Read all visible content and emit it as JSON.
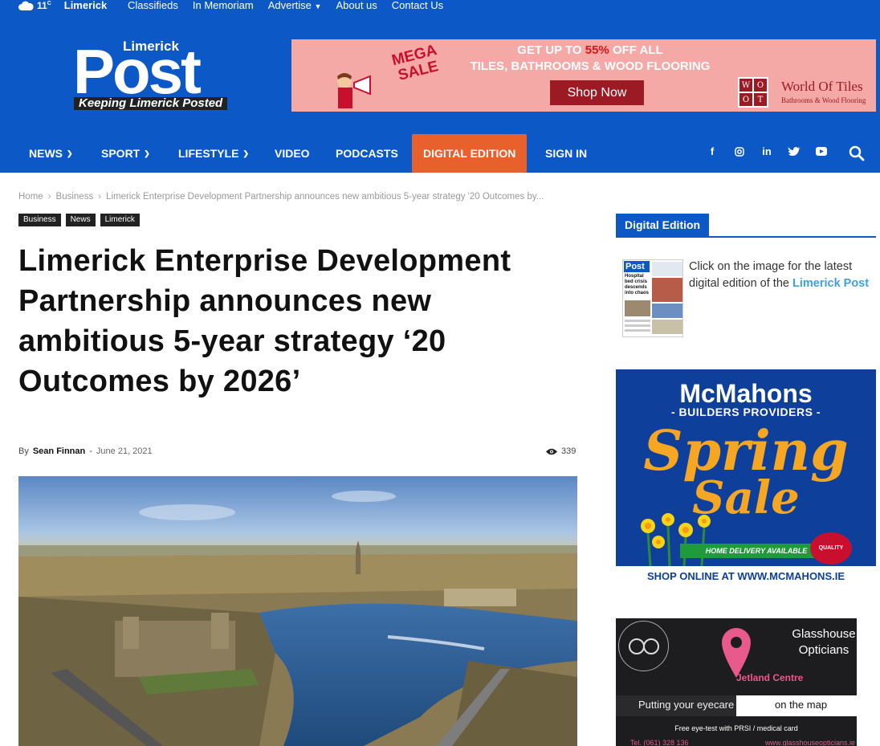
{
  "topbar": {
    "temperature": "11",
    "temperature_unit": "C",
    "location": "Limerick",
    "links": [
      "Classifieds",
      "In Memoriam",
      "Advertise",
      "About us",
      "Contact Us"
    ]
  },
  "logo": {
    "small": "Limerick",
    "big": "Post",
    "tagline": "Keeping Limerick Posted"
  },
  "top_ad": {
    "badge_line1": "MEGA",
    "badge_line2": "SALE",
    "line1_prefix": "GET UP TO ",
    "line1_pct": "55%",
    "line1_suffix": " OFF ALL",
    "line2": "TILES, BATHROOMS & WOOD FLOORING",
    "button": "Shop Now",
    "brand_name": "World Of Tiles",
    "brand_sub": "Bathrooms & Wood Flooring",
    "brand_letters": [
      "W",
      "O",
      "O",
      "T"
    ]
  },
  "nav": {
    "news": "NEWS",
    "sport": "SPORT",
    "lifestyle": "LIFESTYLE",
    "video": "VIDEO",
    "podcasts": "PODCASTS",
    "digital_edition": "DIGITAL EDITION",
    "sign_in": "SIGN IN"
  },
  "social": {
    "facebook": "f",
    "linkedin": "in"
  },
  "breadcrumb": {
    "home": "Home",
    "section": "Business",
    "current": "Limerick Enterprise Development Partnership announces new ambitious 5-year strategy '20 Outcomes by..."
  },
  "tags": [
    "Business",
    "News",
    "Limerick"
  ],
  "article": {
    "title": "Limerick Enterprise Development Partnership announces new ambitious 5-year strategy ‘20 Outcomes by 2026’",
    "by": "By",
    "author": "Sean Finnan",
    "dash": "-",
    "date": "June 21, 2021",
    "views": "339"
  },
  "sidebar": {
    "heading": "Digital Edition",
    "text": "Click on the image for the latest digital edition of the ",
    "link": "Limerick Post",
    "thumb_masthead": "Post",
    "thumb_headline": "Hospital bed crisis descends into chaos"
  },
  "mcmahons_ad": {
    "brand": "McMahons",
    "sub": "- BUILDERS PROVIDERS -",
    "spring": "Spring",
    "sale": "Sale",
    "delivery": "HOME DELIVERY AVAILABLE",
    "badge": "QUALITY",
    "shop": "SHOP ONLINE AT WWW.MCMAHONS.IE"
  },
  "glasshouse_ad": {
    "name_line1": "Glasshouse",
    "name_line2": "Opticians",
    "centre": "Jetland Centre",
    "tag_left": "Putting your eyecare",
    "tag_right": "on the map",
    "free": "Free eye-test with PRSI / medical card",
    "phone": "Tel. (061) 328 136",
    "web": "www.glasshouseopticians.ie"
  },
  "colors": {
    "brand_blue": "#0b58c6",
    "digital_orange": "#e8602c",
    "link_blue": "#3fa0e0"
  }
}
